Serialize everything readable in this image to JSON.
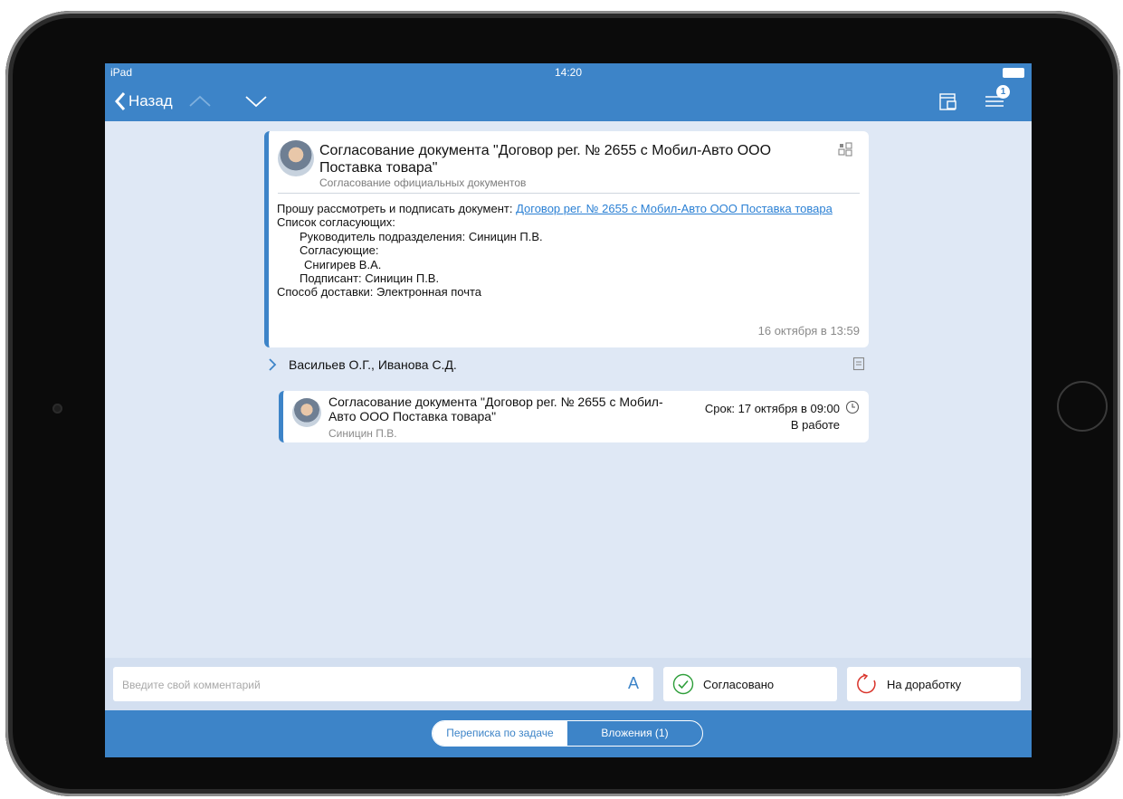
{
  "statusbar": {
    "device": "iPad",
    "time": "14:20"
  },
  "navbar": {
    "back_label": "Назад",
    "notifications_count": "1"
  },
  "task_card": {
    "title": "Согласование документа \"Договор рег. № 2655 с Мобил-Авто ООО Поставка товара\"",
    "subtitle": "Согласование официальных документов",
    "request_text": "Прошу рассмотреть и подписать документ: ",
    "document_link": "Договор рег. № 2655 с Мобил-Авто ООО Поставка товара",
    "approvers_heading": "Список согласующих:",
    "head_line": "Руководитель подразделения: Синицин П.В.",
    "approvers_label": "Согласующие:",
    "approver_name": "Снигирев В.А.",
    "signer_line": "Подписант: Синицин П.В.",
    "delivery_line": "Способ доставки: Электронная почта",
    "date": "16 октября в 13:59"
  },
  "participants": {
    "names": "Васильев О.Г., Иванова С.Д."
  },
  "subtask": {
    "title": "Согласование документа \"Договор рег. № 2655 с Мобил-Авто ООО Поставка товара\"",
    "author": "Синицин П.В.",
    "deadline": "Срок: 17 октября в 09:00",
    "status": "В работе"
  },
  "comment": {
    "placeholder": "Введите свой комментарий",
    "format_label": "A"
  },
  "actions": {
    "approve_label": "Согласовано",
    "rework_label": "На доработку"
  },
  "tabs": [
    {
      "label": "Переписка по задаче"
    },
    {
      "label": "Вложения (1)"
    }
  ],
  "colors": {
    "accent": "#3d84c8",
    "approve": "#2e9e3a",
    "rework": "#d9342b"
  }
}
